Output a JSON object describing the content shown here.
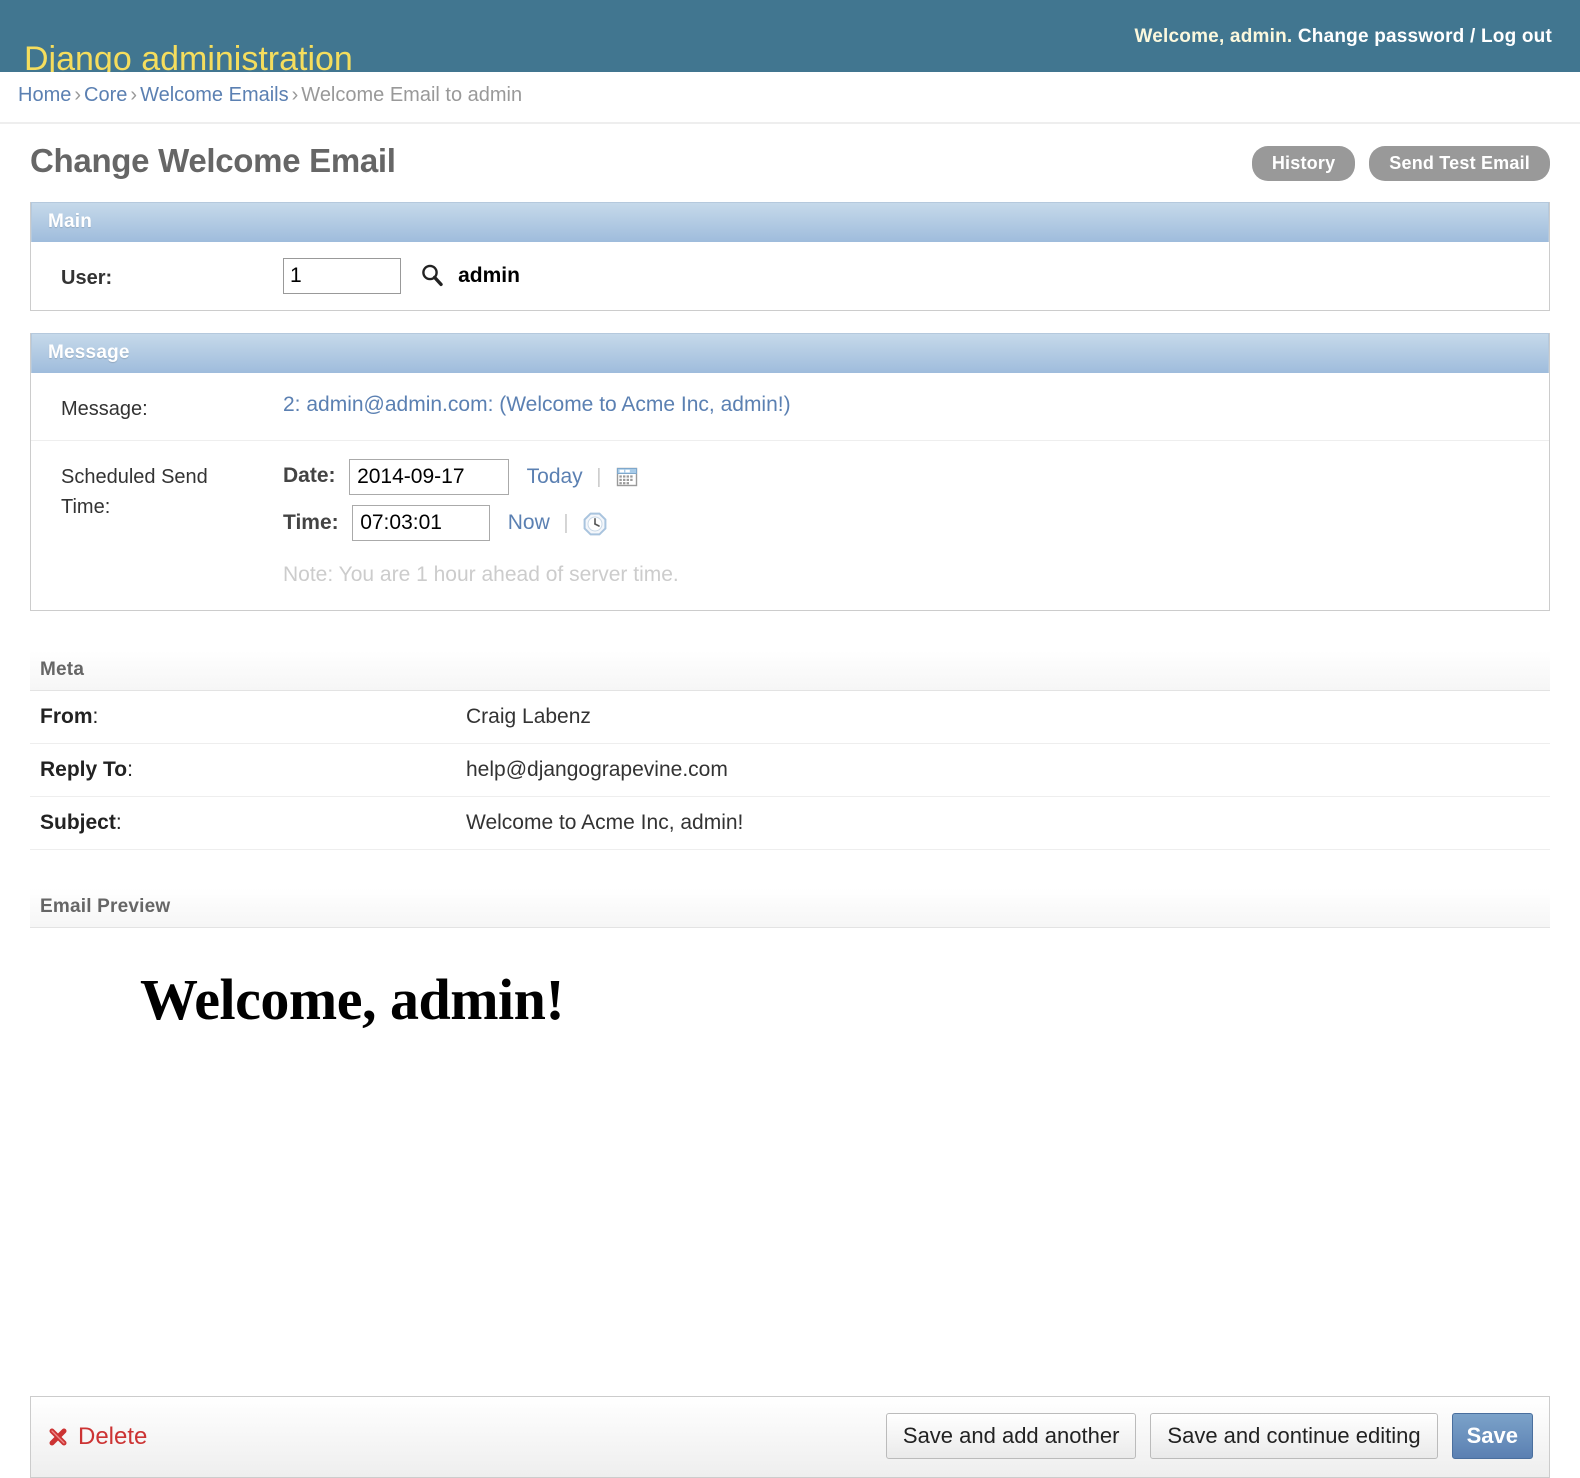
{
  "header": {
    "site_name": "Django administration",
    "welcome_prefix": "Welcome,",
    "username": "admin",
    "username_suffix": ".",
    "change_password": "Change password",
    "separator": "/",
    "log_out": "Log out",
    "bg_color": "#417690",
    "title_color": "#f5dd5d"
  },
  "breadcrumbs": {
    "items": [
      {
        "label": "Home",
        "link": true
      },
      {
        "label": "Core",
        "link": true
      },
      {
        "label": "Welcome Emails",
        "link": true
      },
      {
        "label": "Welcome Email to admin",
        "link": false
      }
    ],
    "divider": "›"
  },
  "page": {
    "title": "Change Welcome Email"
  },
  "object_tools": [
    {
      "label": "History",
      "name": "history-button"
    },
    {
      "label": "Send Test Email",
      "name": "send-test-email-button"
    }
  ],
  "fieldsets": {
    "main": {
      "legend": "Main",
      "user_label": "User:",
      "user_value": "1",
      "user_display": "admin",
      "lookup_icon": "search-icon"
    },
    "message": {
      "legend": "Message",
      "message_label": "Message:",
      "message_value": "2: admin@admin.com: (Welcome to Acme Inc, admin!)",
      "scheduled_label": "Scheduled Send Time:",
      "date_label": "Date:",
      "date_value": "2014-09-17",
      "today_label": "Today",
      "calendar_icon": "calendar-icon",
      "time_label": "Time:",
      "time_value": "07:03:01",
      "now_label": "Now",
      "clock_icon": "clock-icon",
      "pipe": "|",
      "note": "Note: You are 1 hour ahead of server time."
    }
  },
  "meta": {
    "heading": "Meta",
    "rows": [
      {
        "key": "From",
        "colon": ":",
        "value": "Craig Labenz"
      },
      {
        "key": "Reply To",
        "colon": ":",
        "value": "help@djangograpevine.com"
      },
      {
        "key": "Subject",
        "colon": ":",
        "value": "Welcome to Acme Inc, admin!"
      }
    ]
  },
  "preview": {
    "heading": "Email Preview",
    "body_heading": "Welcome, admin!"
  },
  "submit_row": {
    "delete_label": "Delete",
    "delete_icon": "delete-x-icon",
    "delete_color": "#cc3333",
    "save_add_another": "Save and add another",
    "save_continue": "Save and continue editing",
    "save": "Save",
    "save_color": "#5b80b2"
  }
}
